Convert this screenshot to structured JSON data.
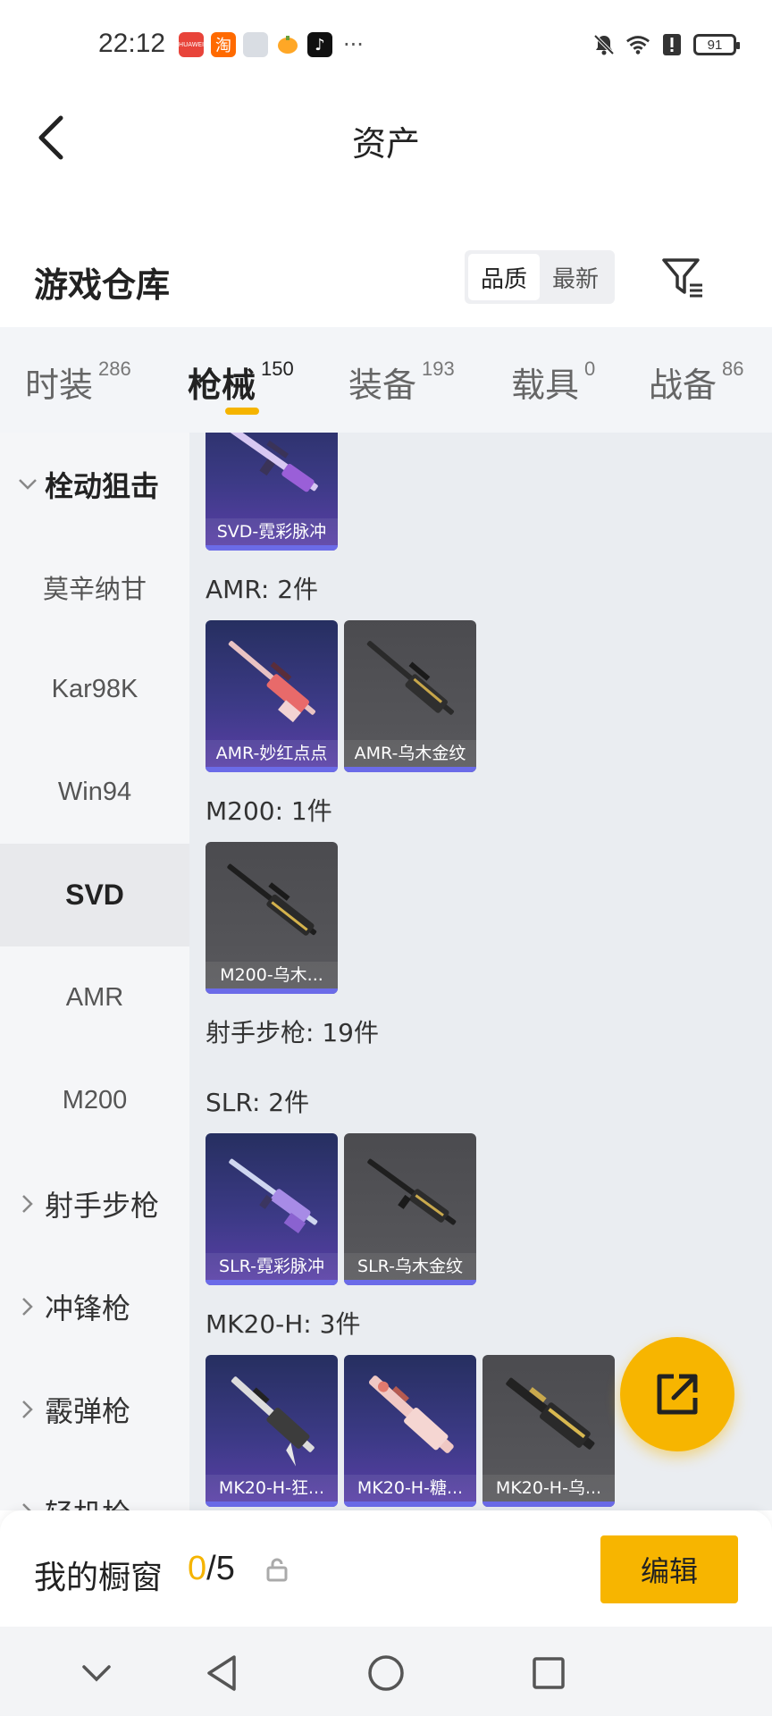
{
  "status_bar": {
    "time": "22:12",
    "battery": "91",
    "apps": [
      {
        "icon": "huawei-mall-icon",
        "color": "#e8443a",
        "text": "HUAWEI"
      },
      {
        "icon": "taobao-icon",
        "color": "#ff6a00",
        "text": "淘"
      },
      {
        "icon": "box-app-icon",
        "color": "#d9dde3",
        "text": ""
      },
      {
        "icon": "orange-app-icon",
        "color": "#ffa726",
        "text": ""
      },
      {
        "icon": "tiktok-icon",
        "color": "#111111",
        "text": "♪"
      }
    ],
    "more": "···"
  },
  "header": {
    "title": "资产"
  },
  "warehouse": {
    "title": "游戏仓库",
    "sort_options": [
      "品质",
      "最新"
    ],
    "active_sort": "品质"
  },
  "tabs": [
    {
      "label": "时装",
      "count": "286"
    },
    {
      "label": "枪械",
      "count": "150",
      "active": true
    },
    {
      "label": "装备",
      "count": "193"
    },
    {
      "label": "载具",
      "count": "0"
    },
    {
      "label": "战备",
      "count": "86"
    }
  ],
  "sidebar": {
    "items": [
      {
        "label": "栓动狙击",
        "type": "group-expanded"
      },
      {
        "label": "莫辛纳甘"
      },
      {
        "label": "Kar98K"
      },
      {
        "label": "Win94"
      },
      {
        "label": "SVD",
        "selected": true
      },
      {
        "label": "AMR"
      },
      {
        "label": "M200"
      },
      {
        "label": "射手步枪",
        "type": "group"
      },
      {
        "label": "冲锋枪",
        "type": "group"
      },
      {
        "label": "霰弹枪",
        "type": "group"
      },
      {
        "label": "轻机枪",
        "type": "group"
      }
    ]
  },
  "content": {
    "sections": [
      {
        "label": "AMR: 2件"
      },
      {
        "label": "M200: 1件"
      },
      {
        "label": "射手步枪: 19件"
      },
      {
        "label": "SLR: 2件"
      },
      {
        "label": "MK20-H: 3件"
      }
    ],
    "cards": [
      {
        "name": "SVD-霓彩脉冲",
        "style": "purple"
      },
      {
        "name": "AMR-妙红点点",
        "style": "purple"
      },
      {
        "name": "AMR-乌木金纹",
        "style": "grey"
      },
      {
        "name": "M200-乌木...",
        "style": "grey"
      },
      {
        "name": "SLR-霓彩脉冲",
        "style": "purple"
      },
      {
        "name": "SLR-乌木金纹",
        "style": "grey"
      },
      {
        "name": "MK20-H-狂...",
        "style": "purple"
      },
      {
        "name": "MK20-H-糖...",
        "style": "purple"
      },
      {
        "name": "MK20-H-乌...",
        "style": "grey"
      }
    ]
  },
  "showcase": {
    "title": "我的橱窗",
    "current": "0",
    "total": "/5",
    "edit_label": "编辑"
  },
  "colors": {
    "accent": "#f7b500",
    "rarity_bar": "#6b6be8",
    "sidebar_bg": "#f5f6f8",
    "content_bg": "#eaedf1"
  }
}
